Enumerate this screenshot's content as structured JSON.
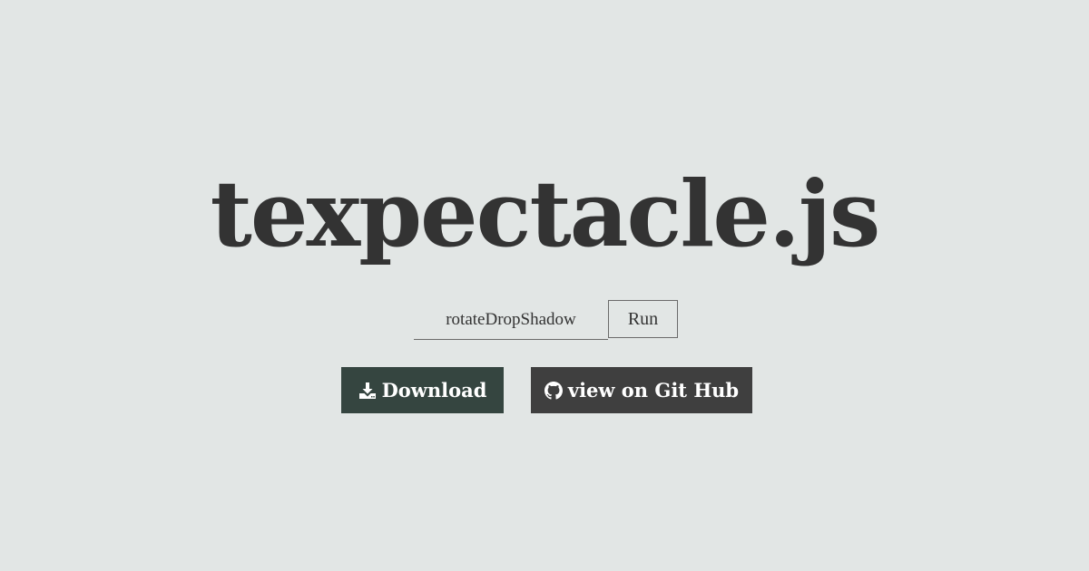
{
  "page": {
    "title": "texpectacle.js"
  },
  "controls": {
    "effect_value": "rotateDropShadow",
    "run_label": "Run"
  },
  "actions": {
    "download": {
      "label": "Download",
      "icon": "download-icon"
    },
    "github": {
      "label": "view on Git Hub",
      "icon": "github-icon"
    }
  },
  "colors": {
    "background": "#e2e6e5",
    "title": "#333333",
    "download_button": "#354540",
    "github_button": "#3f3f3f"
  }
}
